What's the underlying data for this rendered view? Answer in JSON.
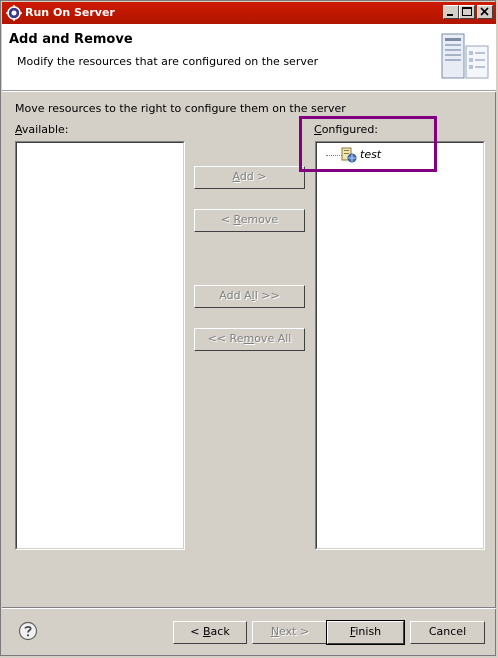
{
  "window": {
    "title": "Run On Server",
    "controls": [
      "minimize",
      "maximize",
      "close"
    ]
  },
  "header": {
    "title": "Add and Remove",
    "description": "Modify the resources that are configured on the server"
  },
  "instruction": "Move resources to the right to configure them on the server",
  "available": {
    "label_mnemonic": "A",
    "label_rest": "vailable:",
    "items": []
  },
  "configured": {
    "label_mnemonic": "C",
    "label_rest": "onfigured:",
    "items": [
      {
        "label": "test",
        "icon": "web-module-icon"
      }
    ]
  },
  "actions": {
    "add": {
      "pre": "",
      "mn": "A",
      "post": "dd >"
    },
    "remove": {
      "pre": "< ",
      "mn": "R",
      "post": "emove"
    },
    "add_all": {
      "pre": "Add A",
      "mn": "l",
      "post": "l >>"
    },
    "remove_all": {
      "pre": "<< Re",
      "mn": "m",
      "post": "ove All"
    }
  },
  "footer": {
    "back": {
      "pre": "< ",
      "mn": "B",
      "post": "ack"
    },
    "next": {
      "pre": "",
      "mn": "N",
      "post": "ext >"
    },
    "finish": {
      "pre": "",
      "mn": "F",
      "post": "inish"
    },
    "cancel": "Cancel"
  },
  "colors": {
    "titlebar": "#cc1a00",
    "highlight": "#800080",
    "dialog_bg": "#d4d0c8"
  }
}
